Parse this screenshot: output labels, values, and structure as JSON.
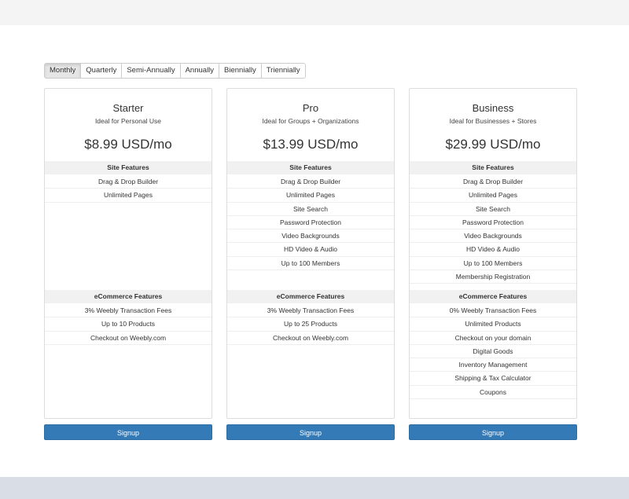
{
  "billing_cycles": [
    {
      "label": "Monthly",
      "active": true
    },
    {
      "label": "Quarterly",
      "active": false
    },
    {
      "label": "Semi-Annually",
      "active": false
    },
    {
      "label": "Annually",
      "active": false
    },
    {
      "label": "Biennially",
      "active": false
    },
    {
      "label": "Triennially",
      "active": false
    }
  ],
  "plans": [
    {
      "name": "Starter",
      "tagline": "Ideal for Personal Use",
      "price": "$8.99 USD/mo",
      "site_header": "Site Features",
      "site_features": [
        "Drag & Drop Builder",
        "Unlimited Pages"
      ],
      "ecom_header": "eCommerce Features",
      "ecom_features": [
        "3% Weebly Transaction Fees",
        "Up to 10 Products",
        "Checkout on Weebly.com"
      ],
      "signup_label": "Signup"
    },
    {
      "name": "Pro",
      "tagline": "Ideal for Groups + Organizations",
      "price": "$13.99 USD/mo",
      "site_header": "Site Features",
      "site_features": [
        "Drag & Drop Builder",
        "Unlimited Pages",
        "Site Search",
        "Password Protection",
        "Video Backgrounds",
        "HD Video & Audio",
        "Up to 100 Members"
      ],
      "ecom_header": "eCommerce Features",
      "ecom_features": [
        "3% Weebly Transaction Fees",
        "Up to 25 Products",
        "Checkout on Weebly.com"
      ],
      "signup_label": "Signup"
    },
    {
      "name": "Business",
      "tagline": "Ideal for Businesses + Stores",
      "price": "$29.99 USD/mo",
      "site_header": "Site Features",
      "site_features": [
        "Drag & Drop Builder",
        "Unlimited Pages",
        "Site Search",
        "Password Protection",
        "Video Backgrounds",
        "HD Video & Audio",
        "Up to 100 Members",
        "Membership Registration"
      ],
      "ecom_header": "eCommerce Features",
      "ecom_features": [
        "0% Weebly Transaction Fees",
        "Unlimited Products",
        "Checkout on your domain",
        "Digital Goods",
        "Inventory Management",
        "Shipping & Tax Calculator",
        "Coupons"
      ],
      "signup_label": "Signup"
    }
  ],
  "colors": {
    "primary_button": "#337ab7",
    "section_header_bg": "#f1f1f1",
    "footer_band": "#d8dde6"
  }
}
